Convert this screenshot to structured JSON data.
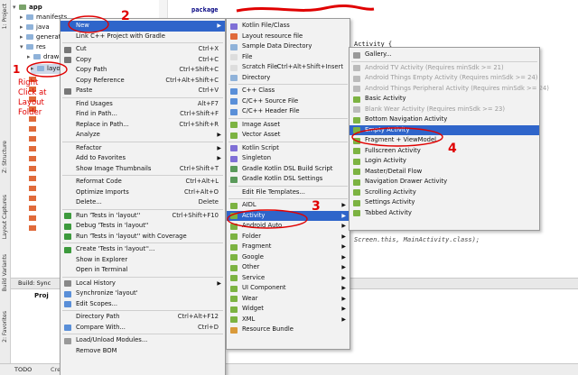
{
  "left_strip": {
    "project_label": "1: Project",
    "structure_label": "Z: Structure",
    "captures_label": "Layout Captures",
    "variants_label": "Build Variants",
    "favorites_label": "2: Favorites"
  },
  "tree": {
    "items": [
      "app",
      "manifests",
      "java",
      "generated",
      "res",
      "drawable",
      "layout"
    ]
  },
  "editor": {
    "package_kw": "package",
    "line2": "Activity {",
    "line3": "Screen.this, MainActivity.class);"
  },
  "build_bar": {
    "label": "Build: Sync",
    "proj": "Proj"
  },
  "bottom_bar": {
    "todo": "TODO",
    "status": "Create a new Em"
  },
  "annotations": {
    "n1": "1",
    "n2": "2",
    "n3": "3",
    "n4": "4",
    "note": "Right\nClick at\nLayout\nFolder"
  },
  "context_menu": {
    "items": [
      {
        "label": "New",
        "shortcut": "",
        "sub": true,
        "sel": true
      },
      {
        "label": "Link C++ Project with Gradle",
        "shortcut": ""
      },
      {
        "label": "Cut",
        "shortcut": "Ctrl+X"
      },
      {
        "label": "Copy",
        "shortcut": "Ctrl+C"
      },
      {
        "label": "Copy Path",
        "shortcut": "Ctrl+Shift+C"
      },
      {
        "label": "Copy Reference",
        "shortcut": "Ctrl+Alt+Shift+C"
      },
      {
        "label": "Paste",
        "shortcut": "Ctrl+V"
      },
      {
        "label": "Find Usages",
        "shortcut": "Alt+F7"
      },
      {
        "label": "Find in Path...",
        "shortcut": "Ctrl+Shift+F"
      },
      {
        "label": "Replace in Path...",
        "shortcut": "Ctrl+Shift+R"
      },
      {
        "label": "Analyze",
        "shortcut": "",
        "sub": true
      },
      {
        "label": "Refactor",
        "shortcut": "",
        "sub": true
      },
      {
        "label": "Add to Favorites",
        "shortcut": "",
        "sub": true
      },
      {
        "label": "Show Image Thumbnails",
        "shortcut": "Ctrl+Shift+T"
      },
      {
        "label": "Reformat Code",
        "shortcut": "Ctrl+Alt+L"
      },
      {
        "label": "Optimize Imports",
        "shortcut": "Ctrl+Alt+O"
      },
      {
        "label": "Delete...",
        "shortcut": "Delete"
      },
      {
        "label": "Run 'Tests in 'layout''",
        "shortcut": "Ctrl+Shift+F10"
      },
      {
        "label": "Debug 'Tests in 'layout''",
        "shortcut": ""
      },
      {
        "label": "Run 'Tests in 'layout'' with Coverage",
        "shortcut": ""
      },
      {
        "label": "Create 'Tests in 'layout''...",
        "shortcut": ""
      },
      {
        "label": "Show in Explorer",
        "shortcut": ""
      },
      {
        "label": "Open in Terminal",
        "shortcut": ""
      },
      {
        "label": "Local History",
        "shortcut": "",
        "sub": true
      },
      {
        "label": "Synchronize 'layout'",
        "shortcut": ""
      },
      {
        "label": "Edit Scopes...",
        "shortcut": ""
      },
      {
        "label": "Directory Path",
        "shortcut": "Ctrl+Alt+F12"
      },
      {
        "label": "Compare With...",
        "shortcut": "Ctrl+D"
      },
      {
        "label": "Load/Unload Modules...",
        "shortcut": ""
      },
      {
        "label": "Remove BOM",
        "shortcut": ""
      }
    ]
  },
  "new_menu": {
    "items": [
      {
        "label": "Kotlin File/Class"
      },
      {
        "label": "Layout resource file"
      },
      {
        "label": "Sample Data Directory"
      },
      {
        "label": "File"
      },
      {
        "label": "Scratch File",
        "shortcut": "Ctrl+Alt+Shift+Insert"
      },
      {
        "label": "Directory"
      },
      {
        "label": "C++ Class"
      },
      {
        "label": "C/C++ Source File"
      },
      {
        "label": "C/C++ Header File"
      },
      {
        "label": "Image Asset"
      },
      {
        "label": "Vector Asset"
      },
      {
        "label": "Kotlin Script"
      },
      {
        "label": "Singleton"
      },
      {
        "label": "Gradle Kotlin DSL Build Script"
      },
      {
        "label": "Gradle Kotlin DSL Settings"
      },
      {
        "label": "Edit File Templates..."
      },
      {
        "label": "AIDL",
        "sub": true
      },
      {
        "label": "Activity",
        "sub": true,
        "sel": true
      },
      {
        "label": "Android Auto",
        "sub": true
      },
      {
        "label": "Folder",
        "sub": true
      },
      {
        "label": "Fragment",
        "sub": true
      },
      {
        "label": "Google",
        "sub": true
      },
      {
        "label": "Other",
        "sub": true
      },
      {
        "label": "Service",
        "sub": true
      },
      {
        "label": "UI Component",
        "sub": true
      },
      {
        "label": "Wear",
        "sub": true
      },
      {
        "label": "Widget",
        "sub": true
      },
      {
        "label": "XML",
        "sub": true
      },
      {
        "label": "Resource Bundle"
      }
    ]
  },
  "activity_menu": {
    "items": [
      {
        "label": "Gallery..."
      },
      {
        "label": "Android TV Activity (Requires minSdk >= 21)",
        "dis": true
      },
      {
        "label": "Android Things Empty Activity (Requires minSdk >= 24)",
        "dis": true
      },
      {
        "label": "Android Things Peripheral Activity (Requires minSdk >= 24)",
        "dis": true
      },
      {
        "label": "Basic Activity"
      },
      {
        "label": "Blank Wear Activity (Requires minSdk >= 23)",
        "dis": true
      },
      {
        "label": "Bottom Navigation Activity"
      },
      {
        "label": "Empty Activity",
        "sel": true
      },
      {
        "label": "Fragment + ViewModel"
      },
      {
        "label": "Fullscreen Activity"
      },
      {
        "label": "Login Activity"
      },
      {
        "label": "Master/Detail Flow"
      },
      {
        "label": "Navigation Drawer Activity"
      },
      {
        "label": "Scrolling Activity"
      },
      {
        "label": "Settings Activity"
      },
      {
        "label": "Tabbed Activity"
      }
    ]
  },
  "colors": {
    "accent": "#2f65ca",
    "annotation": "#e00000",
    "android_green": "#7cb342"
  }
}
